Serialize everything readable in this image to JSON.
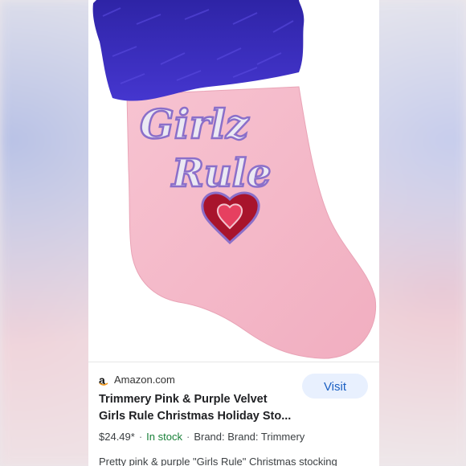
{
  "source": {
    "icon": "amazon-icon",
    "name": "Amazon.com"
  },
  "visit_label": "Visit",
  "product": {
    "title_line1": "Trimmery Pink & Purple Velvet",
    "title_line2": "Girls Rule Christmas Holiday Sto...",
    "price": "$24.49*",
    "stock": "In stock",
    "brand": "Brand: Brand: Trimmery",
    "description": "Pretty pink & purple \"Girls Rule\" Christmas stocking"
  },
  "image": {
    "embroidery_line1": "Girlz",
    "embroidery_line2": "Rule"
  },
  "colors": {
    "stocking_pink": "#f4b9c9",
    "cuff_purple": "#3b2fc0",
    "heart_red": "#b5122e",
    "link_blue": "#1a5fc2",
    "stock_green": "#188038"
  }
}
